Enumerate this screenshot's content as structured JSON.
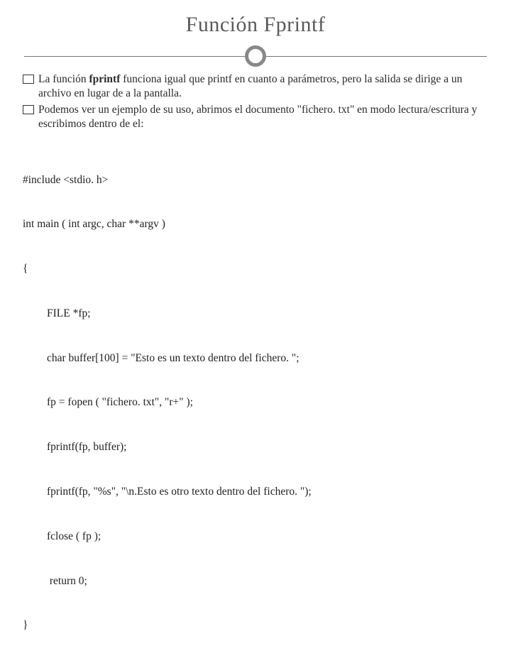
{
  "title": "Función Fprintf",
  "bullets": [
    {
      "pre": "La función ",
      "bold": "fprintf",
      "post": " funciona igual que printf en cuanto a parámetros, pero la salida se dirige a un archivo en lugar de a la pantalla."
    },
    {
      "pre": "Podemos ver un ejemplo de su uso, abrimos el documento \"fichero. txt\" en modo lectura/escritura y escribimos dentro de el:",
      "bold": "",
      "post": ""
    }
  ],
  "code": {
    "l1": "#include <stdio. h>",
    "l2": "int main ( int argc, char **argv )",
    "l3": "{",
    "l4": "FILE *fp;",
    "l5": "char buffer[100] = \"Esto es un texto dentro del fichero. \";",
    "l6": "fp = fopen ( \"fichero. txt\", \"r+\" );",
    "l7": "fprintf(fp, buffer);",
    "l8": "fprintf(fp, \"%s\", \"\\n.Esto es otro texto dentro del fichero. \");",
    "l9": "fclose ( fp );",
    "l10": " return 0;",
    "l11": "}"
  }
}
